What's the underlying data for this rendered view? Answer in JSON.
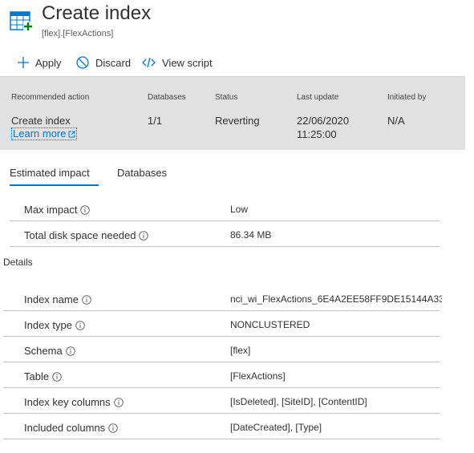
{
  "header": {
    "title": "Create index",
    "subtitle": "[flex].[FlexActions]",
    "icon": "table-add-icon"
  },
  "toolbar": {
    "apply_label": "Apply",
    "discard_label": "Discard",
    "view_script_label": "View script"
  },
  "summary": {
    "columns": {
      "recommended_action": "Recommended action",
      "databases": "Databases",
      "status": "Status",
      "last_update": "Last update",
      "initiated_by": "Initiated by"
    },
    "values": {
      "recommended_action": "Create index",
      "learn_more": "Learn more",
      "databases": "1/1",
      "status": "Reverting",
      "last_update_date": "22/06/2020",
      "last_update_time": "11:25:00",
      "initiated_by": "N/A"
    }
  },
  "tabs": [
    {
      "label": "Estimated impact",
      "active": true
    },
    {
      "label": "Databases",
      "active": false
    }
  ],
  "impact": {
    "max_impact_label": "Max impact",
    "max_impact_value": "Low",
    "disk_label": "Total disk space needed",
    "disk_value": "86.34 MB"
  },
  "details": {
    "section_label": "Details",
    "rows": [
      {
        "label": "Index name",
        "value": "nci_wi_FlexActions_6E4A2EE58FF9DE15144A33"
      },
      {
        "label": "Index type",
        "value": "NONCLUSTERED"
      },
      {
        "label": "Schema",
        "value": "[flex]"
      },
      {
        "label": "Table",
        "value": "[FlexActions]"
      },
      {
        "label": "Index key columns",
        "value": "[IsDeleted], [SiteID], [ContentID]"
      },
      {
        "label": "Included columns",
        "value": "[DateCreated], [Type]"
      }
    ]
  },
  "colors": {
    "accent": "#0078d4",
    "icon_green": "#107c10",
    "band_bg": "#e1e1e1"
  }
}
